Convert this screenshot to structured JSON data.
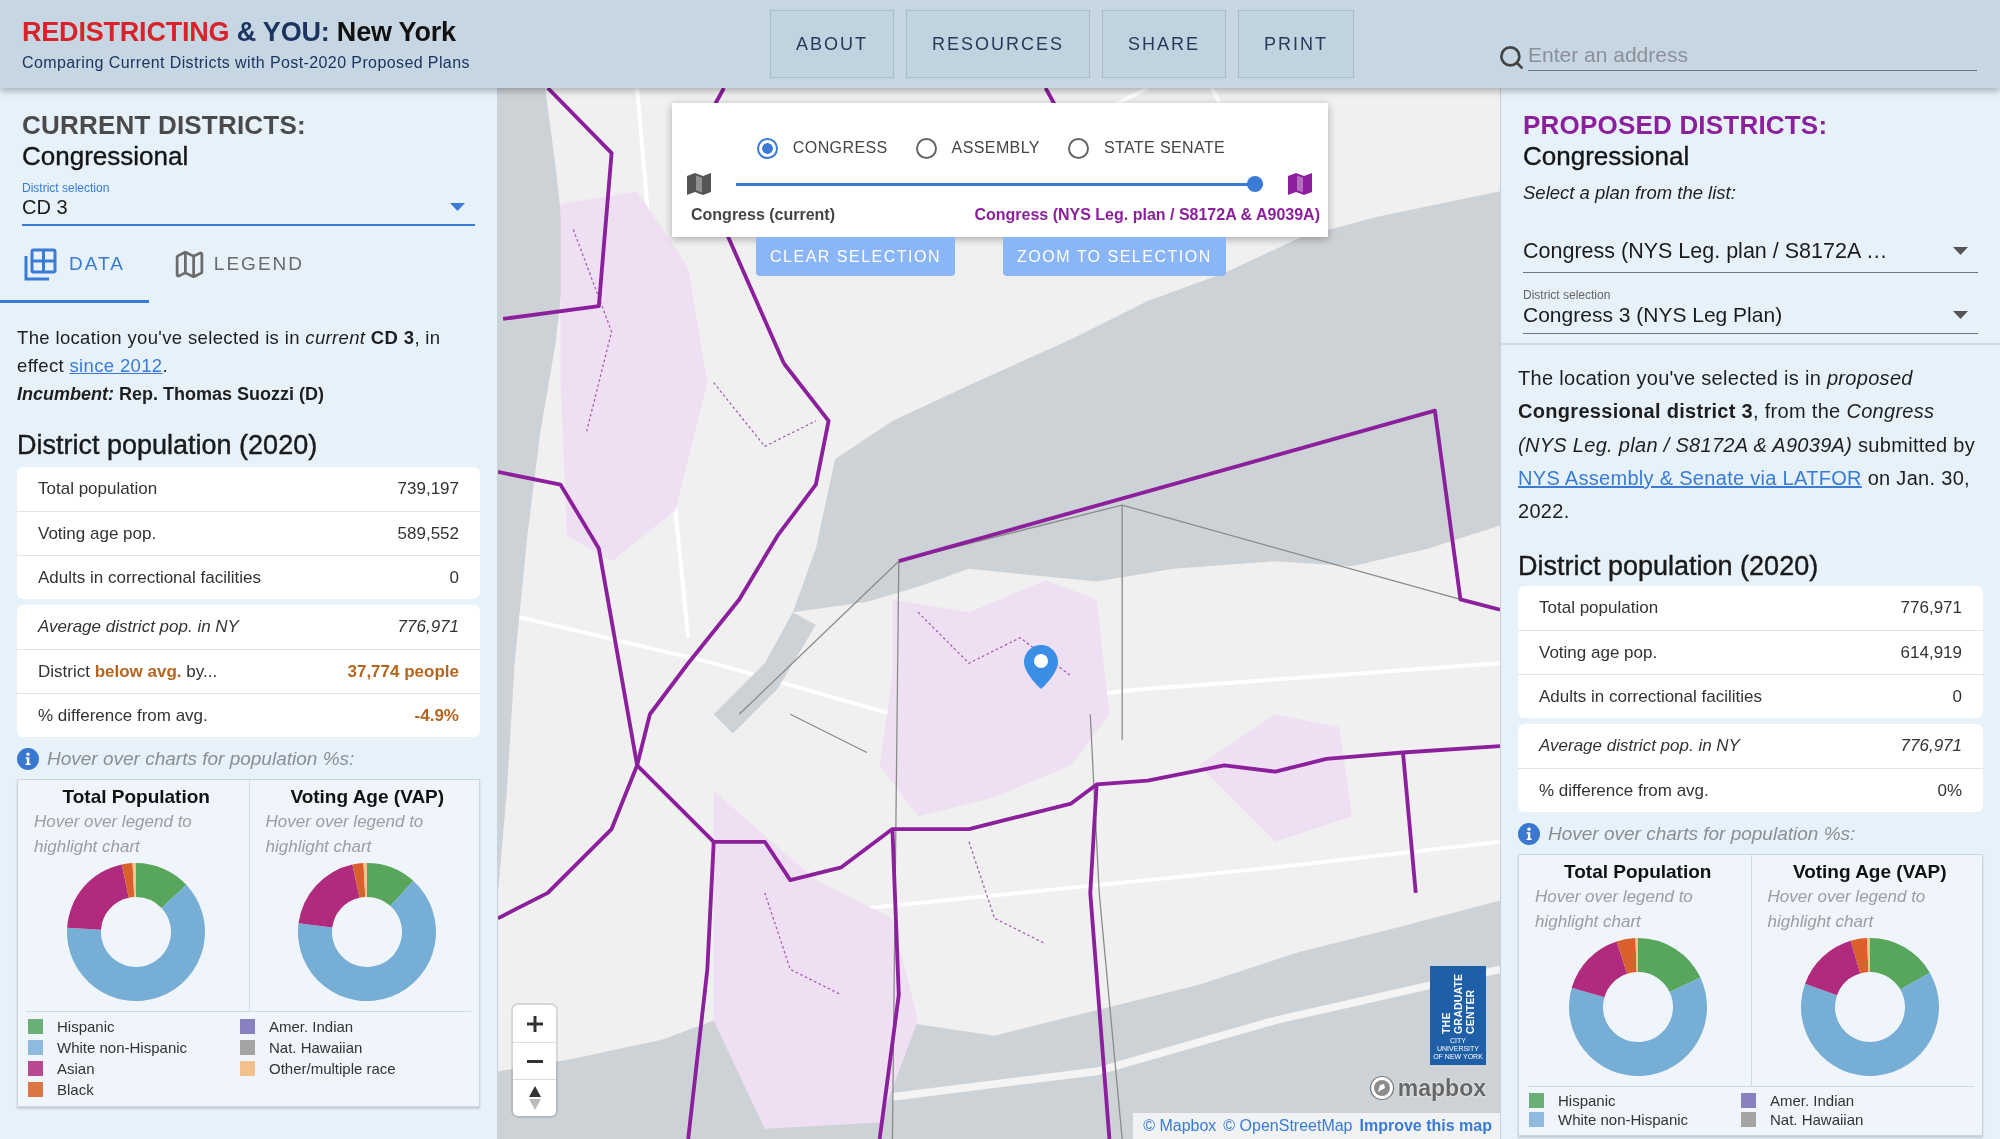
{
  "header": {
    "title": [
      "REDISTRICTING",
      "& YOU:",
      "New York"
    ],
    "subtitle": "Comparing Current Districts with Post-2020 Proposed Plans"
  },
  "nav": [
    "ABOUT",
    "RESOURCES",
    "SHARE",
    "PRINT"
  ],
  "search": {
    "placeholder": "Enter an address"
  },
  "current_panel": {
    "heading": "CURRENT DISTRICTS:",
    "subheading": "Congressional",
    "district_select": {
      "label": "District selection",
      "value": "CD 3",
      "focused": true
    },
    "tabs": [
      {
        "label": "DATA",
        "selected": true
      },
      {
        "label": "LEGEND",
        "selected": false
      }
    ],
    "summary": {
      "text": "The location you've selected is in *current* **CD 3**, in effect ",
      "link": "since 2012",
      "after": "."
    },
    "incumbent": "*Incumbent:* Rep. Thomas Suozzi (D)",
    "population_heading": "District population (2020)",
    "stats_tables": [
      {
        "rows": [
          {
            "label": "Total population",
            "value": "739,197",
            "kind": "count"
          },
          {
            "label": "Voting age pop.",
            "value": "589,552",
            "kind": "count"
          },
          {
            "label": "Adults in correctional facilities",
            "value": "0",
            "kind": "count"
          }
        ]
      },
      {
        "rows": [
          {
            "label": "Average district pop. in NY",
            "value": "776,971",
            "kind": "average"
          },
          {
            "label": "District **below avg.** by...",
            "value": "37,774 people",
            "kind": "alert"
          },
          {
            "label": "% difference from avg.",
            "value": "-4.9%",
            "kind": "alert"
          }
        ]
      }
    ],
    "hint": "Hover over charts for population %s:",
    "charts": [
      {
        "title": "Total Population",
        "subtitle": "Hover over legend to highlight chart"
      },
      {
        "title": "Voting Age (VAP)",
        "subtitle": "Hover over legend to highlight chart"
      }
    ],
    "legend": [
      {
        "label": "Hispanic",
        "color": "#6aaf76"
      },
      {
        "label": "White non-Hispanic",
        "color": "#8ebbdd"
      },
      {
        "label": "Asian",
        "color": "#b8488f"
      },
      {
        "label": "Black",
        "color": "#dc7444"
      },
      {
        "label": "Amer. Indian",
        "color": "#8880bf"
      },
      {
        "label": "Nat. Hawaiian",
        "color": "#a4a4a4"
      },
      {
        "label": "Other/multiple race",
        "color": "#f2c08a"
      }
    ]
  },
  "map": {
    "layer_control": {
      "layers": [
        {
          "label": "CONGRESS",
          "selected": true
        },
        {
          "label": "ASSEMBLY",
          "selected": false
        },
        {
          "label": "STATE SENATE",
          "selected": false
        }
      ],
      "slider": {
        "level": 1,
        "start_label": "Congress (current)",
        "end_label": "Congress (NYS Leg. plan / S8172A & A9039A)"
      }
    },
    "buttons": [
      "CLEAR SELECTION",
      "ZOOM TO SELECTION"
    ],
    "logo": {
      "title_lines": [
        "THE",
        "GRADUATE",
        "CENTER"
      ],
      "subtitle_lines": [
        "CITY UNIVERSITY",
        "OF NEW YORK"
      ]
    },
    "mapbox_logo": "mapbox",
    "attribution": [
      {
        "text": "© Mapbox",
        "kind": "link"
      },
      {
        "text": "© OpenStreetMap",
        "kind": "link"
      },
      {
        "text": "Improve this map",
        "kind": "strong"
      }
    ]
  },
  "proposed_panel": {
    "heading": "PROPOSED DISTRICTS:",
    "subheading": "Congressional",
    "prompt": "Select a plan from the list:",
    "plan_select": {
      "value": "Congress (NYS Leg. plan / S8172A …",
      "focused": false
    },
    "district_select": {
      "label": "District selection",
      "value": "Congress 3 (NYS Leg Plan)",
      "focused": false
    },
    "summary": {
      "text": "The location you've selected is in *proposed* **Congressional district 3**, from the *Congress (NYS Leg. plan / S8172A & A9039A)* submitted by ",
      "link": "NYS Assembly & Senate via LATFOR",
      "after": " on Jan. 30, 2022."
    },
    "population_heading": "District population (2020)",
    "stats_tables": [
      {
        "rows": [
          {
            "label": "Total population",
            "value": "776,971",
            "kind": "count"
          },
          {
            "label": "Voting age pop.",
            "value": "614,919",
            "kind": "count"
          },
          {
            "label": "Adults in correctional facilities",
            "value": "0",
            "kind": "count"
          }
        ]
      },
      {
        "rows": [
          {
            "label": "Average district pop. in NY",
            "value": "776,971",
            "kind": "average"
          },
          {
            "label": "% difference from avg.",
            "value": "0%",
            "kind": "count"
          }
        ]
      }
    ],
    "hint": "Hover over charts for population %s:",
    "charts": [
      {
        "title": "Total Population",
        "subtitle": "Hover over legend to highlight chart"
      },
      {
        "title": "Voting Age (VAP)",
        "subtitle": "Hover over legend to highlight chart"
      }
    ],
    "legend": [
      {
        "label": "Hispanic",
        "color": "#6aaf76"
      },
      {
        "label": "White non-Hispanic",
        "color": "#8ebbdd"
      },
      {
        "label": "Amer. Indian",
        "color": "#8880bf"
      },
      {
        "label": "Nat. Hawaiian",
        "color": "#a4a4a4"
      }
    ]
  }
}
